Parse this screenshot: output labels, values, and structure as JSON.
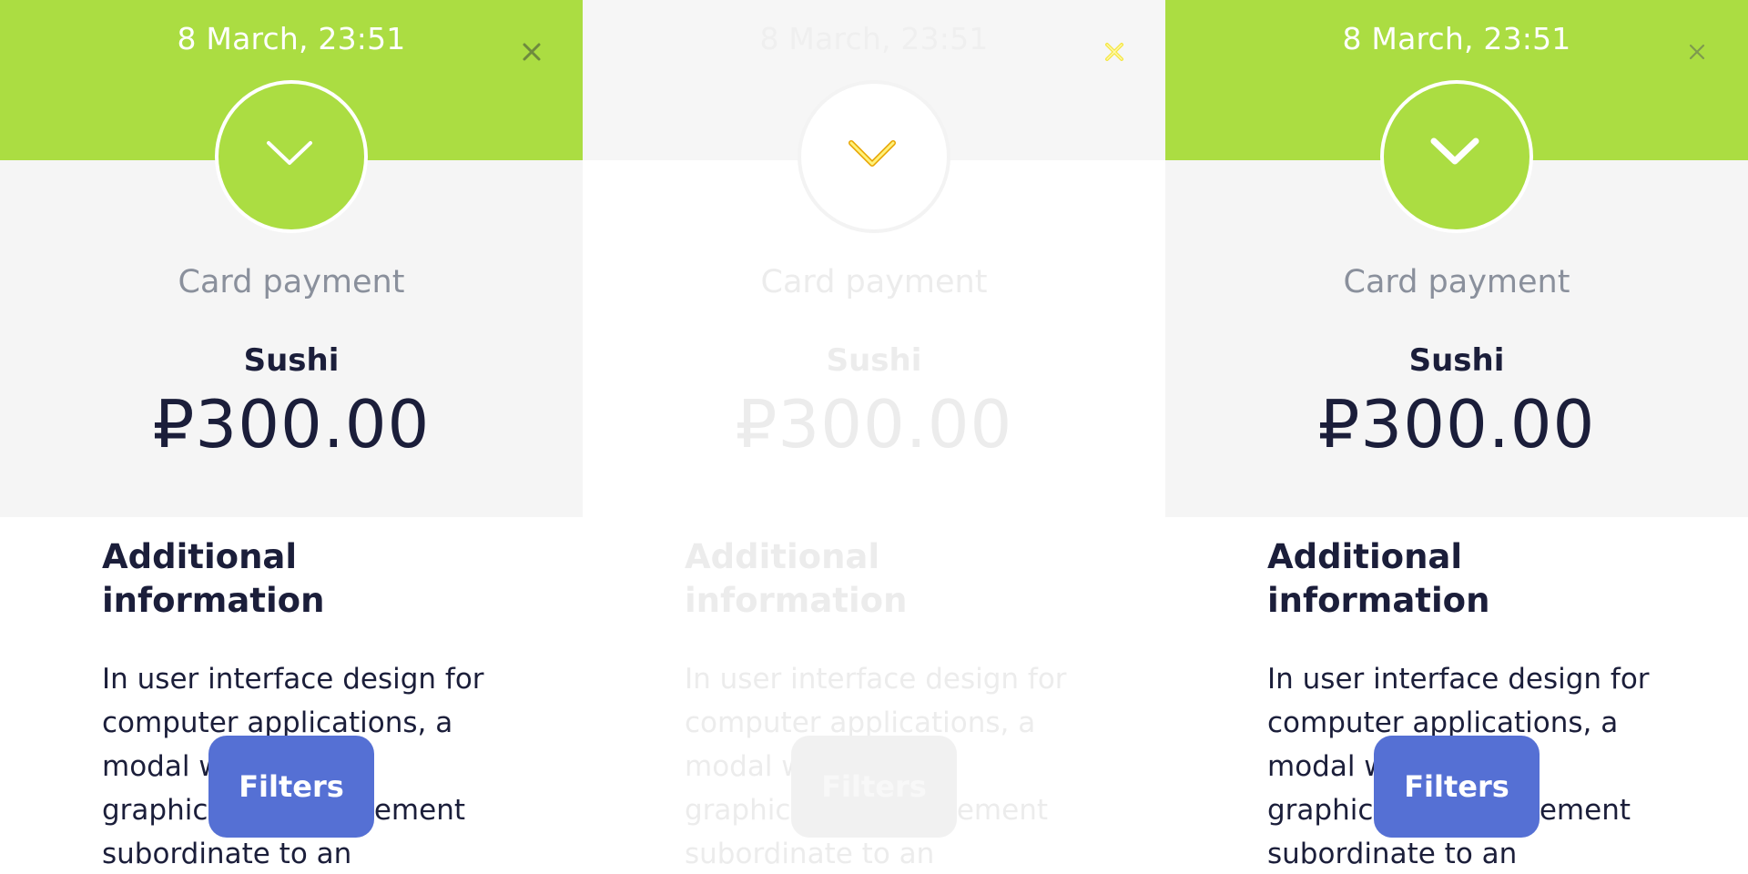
{
  "panels": [
    {
      "variant": "normal",
      "date": "8 March, 23:51",
      "close_icon": "close-icon",
      "status_icon": "chevron-down-icon",
      "payment_method": "Card payment",
      "merchant": "Sushi",
      "amount": "₽300.00",
      "info_title": "Additional information",
      "info_body": "In user interface design for computer applications, a modal window is a graphical control element subordinate to an",
      "filters_label": "Filters"
    },
    {
      "variant": "faded",
      "date": "8 March, 23:51",
      "close_icon": "close-icon",
      "status_icon": "chevron-down-icon",
      "payment_method": "Card payment",
      "merchant": "Sushi",
      "amount": "₽300.00",
      "info_title": "Additional information",
      "info_body": "In user interface design for computer applications, a modal window is a graphical control element subordinate to an",
      "filters_label": "Filters"
    },
    {
      "variant": "normal",
      "date": "8 March, 23:51",
      "close_icon": "close-icon",
      "status_icon": "chevron-down-icon",
      "payment_method": "Card payment",
      "merchant": "Sushi",
      "amount": "₽300.00",
      "info_title": "Additional information",
      "info_body": "In user interface design for computer applications, a modal window is a graphical control element subordinate to an",
      "filters_label": "Filters"
    }
  ],
  "colors": {
    "accent_green": "#ABDD42",
    "summary_bg": "#F5F5F5",
    "text_dark": "#1B1E3A",
    "text_muted": "#8A909C",
    "button_blue": "#5570D4",
    "faded_icon_yellow": "#F5E642"
  }
}
